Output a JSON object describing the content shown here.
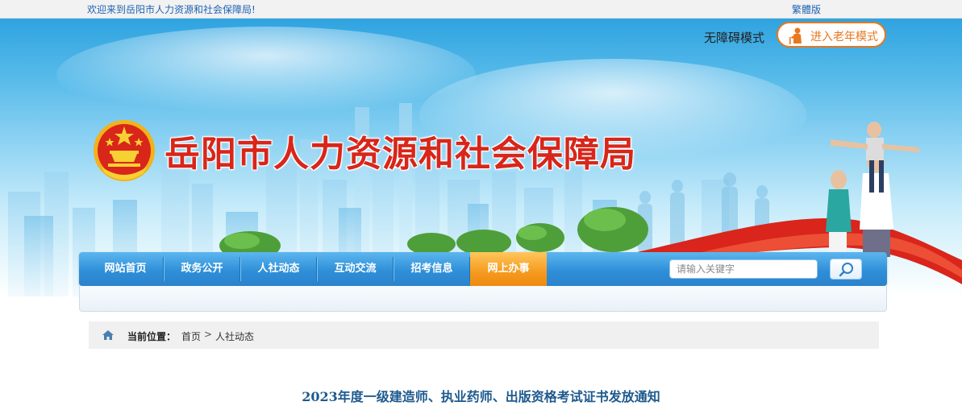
{
  "topbar": {
    "welcome": "欢迎来到岳阳市人力资源和社会保障局!",
    "traditional": "繁體版"
  },
  "header": {
    "site_title": "岳阳市人力资源和社会保障局",
    "accessibility": "无障碍模式",
    "elder_mode": "进入老年模式"
  },
  "nav": {
    "items": [
      {
        "label": "网站首页"
      },
      {
        "label": "政务公开"
      },
      {
        "label": "人社动态"
      },
      {
        "label": "互动交流"
      },
      {
        "label": "招考信息"
      },
      {
        "label": "网上办事",
        "active": true
      }
    ]
  },
  "search": {
    "placeholder": "请输入关键字"
  },
  "breadcrumb": {
    "label": "当前位置：",
    "items": [
      "首页",
      "人社动态"
    ],
    "separator": ">"
  },
  "article": {
    "title": "2023年度一级建造师、执业药师、出版资格考试证书发放通知"
  },
  "colors": {
    "title_red": "#d8261a",
    "nav_blue": "#2f8fd8",
    "nav_active": "#f59a1f",
    "accent_orange": "#e8781f",
    "link_blue": "#1f63b3",
    "article_title": "#1e5a8e"
  },
  "icons": {
    "emblem": "national-emblem",
    "elder": "elder-person-icon",
    "search": "search-icon",
    "home": "home-icon"
  }
}
